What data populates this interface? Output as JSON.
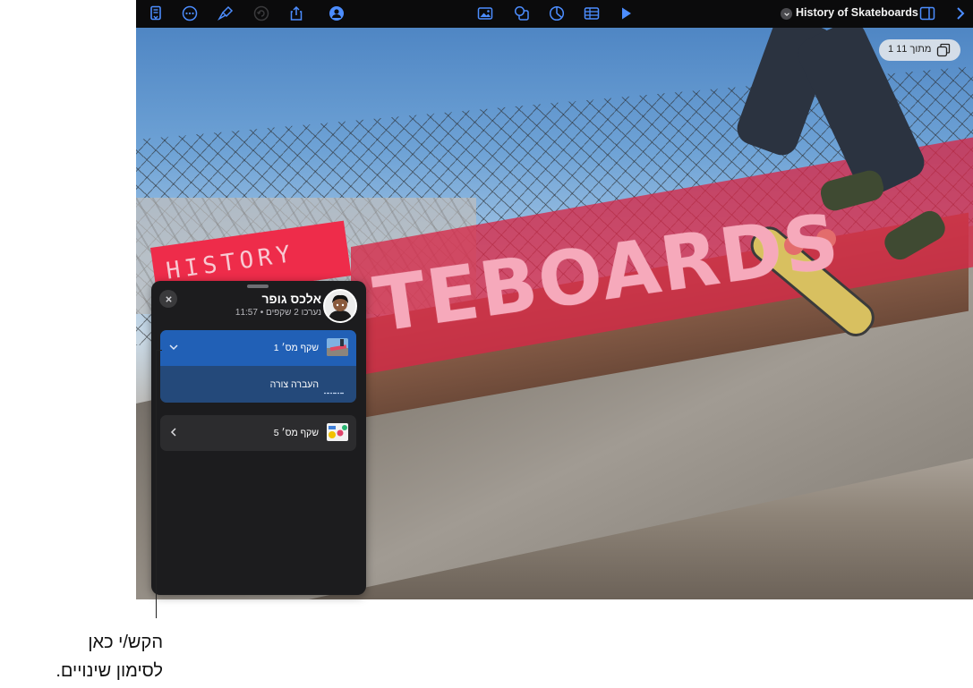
{
  "toolbar": {
    "left_icons": [
      "document-setup-icon",
      "more-icon",
      "format-brush-icon",
      "undo-icon",
      "share-icon",
      "collaborate-icon"
    ],
    "center_icons": [
      "media-icon",
      "shapes-icon",
      "chart-icon",
      "table-icon",
      "play-icon"
    ],
    "document_title": "History of Skateboards",
    "right_icons": [
      "sidebar-icon",
      "chevron-right-icon"
    ]
  },
  "slide": {
    "counter": "1 מתוך 11",
    "title_text_left": "HISTORY OF",
    "title_text_main": "TEBOARDS"
  },
  "activity_panel": {
    "user_name": "אלכס גופר",
    "user_meta": "נערכו 2 שקפים • 11:57",
    "groups": [
      {
        "label": "שקף מס׳ 1",
        "expanded": true,
        "children": [
          {
            "label": "העברה צורה"
          }
        ]
      },
      {
        "label": "שקף מס׳ 5",
        "expanded": false,
        "children": []
      }
    ]
  },
  "callout": {
    "line1": "הקש/י כאן",
    "line2": "לסימון שינויים."
  },
  "colors": {
    "accent": "#2160b6",
    "toolbar_icon": "#4c8dff",
    "panel_bg": "#1c1c1e",
    "slide_red": "#ee2c4a"
  }
}
